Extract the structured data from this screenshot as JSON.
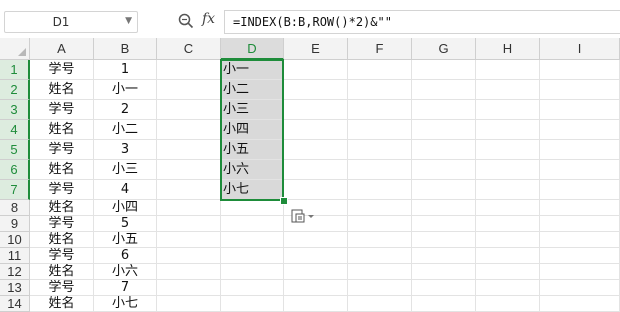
{
  "namebox": {
    "value": "D1"
  },
  "formula": {
    "text": "=INDEX(B:B,ROW()*2)&\"\""
  },
  "icons": {
    "zoom": "zoom-icon",
    "fx": "fx",
    "caret": "chevron-down-icon",
    "paste": "paste-options-icon"
  },
  "columns": [
    "A",
    "B",
    "C",
    "D",
    "E",
    "F",
    "G",
    "H",
    "I"
  ],
  "selected_column": "D",
  "rows": [
    {
      "num": "1",
      "A": "学号",
      "B": "1",
      "D": "小一"
    },
    {
      "num": "2",
      "A": "姓名",
      "B": "小一",
      "D": "小二"
    },
    {
      "num": "3",
      "A": "学号",
      "B": "2",
      "D": "小三"
    },
    {
      "num": "4",
      "A": "姓名",
      "B": "小二",
      "D": "小四"
    },
    {
      "num": "5",
      "A": "学号",
      "B": "3",
      "D": "小五"
    },
    {
      "num": "6",
      "A": "姓名",
      "B": "小三",
      "D": "小六"
    },
    {
      "num": "7",
      "A": "学号",
      "B": "4",
      "D": "小七"
    },
    {
      "num": "8",
      "A": "姓名",
      "B": "小四",
      "D": ""
    },
    {
      "num": "9",
      "A": "学号",
      "B": "5",
      "D": ""
    },
    {
      "num": "10",
      "A": "姓名",
      "B": "小五",
      "D": ""
    },
    {
      "num": "11",
      "A": "学号",
      "B": "6",
      "D": ""
    },
    {
      "num": "12",
      "A": "姓名",
      "B": "小六",
      "D": ""
    },
    {
      "num": "13",
      "A": "学号",
      "B": "7",
      "D": ""
    },
    {
      "num": "14",
      "A": "姓名",
      "B": "小七",
      "D": ""
    }
  ],
  "colors": {
    "accent": "#1e8c3a",
    "selection_fill": "#d9d9d9"
  }
}
